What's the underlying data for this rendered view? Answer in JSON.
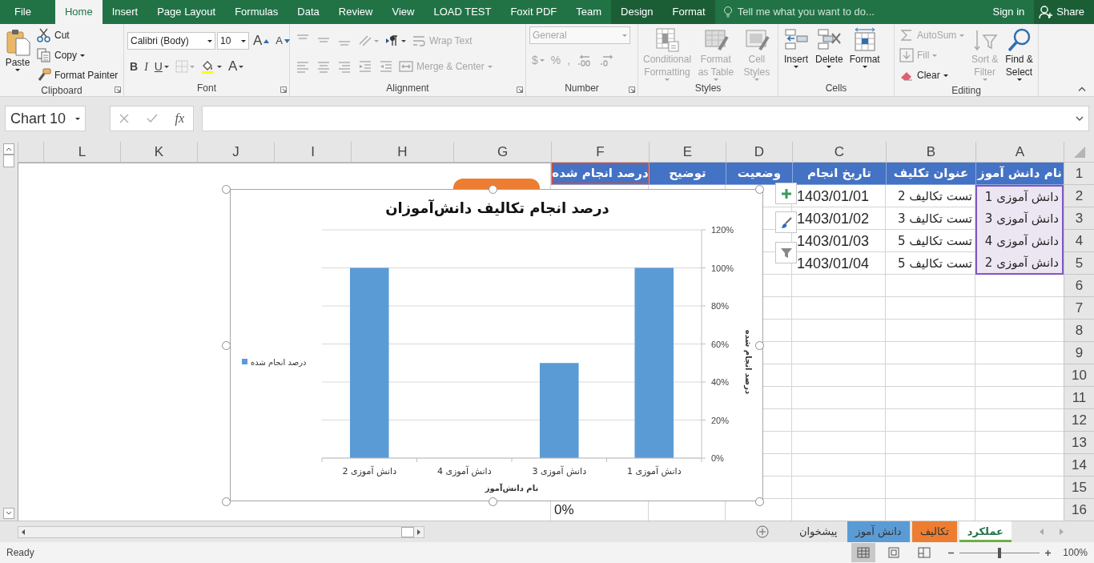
{
  "ribbon_tabs": [
    {
      "label": "Format",
      "selected": false,
      "kind": "contextual"
    },
    {
      "label": "Design",
      "selected": false,
      "kind": "contextual"
    },
    {
      "label": "Team",
      "selected": false,
      "kind": "normal"
    },
    {
      "label": "Foxit PDF",
      "selected": false,
      "kind": "normal"
    },
    {
      "label": "LOAD TEST",
      "selected": false,
      "kind": "normal"
    },
    {
      "label": "View",
      "selected": false,
      "kind": "normal"
    },
    {
      "label": "Review",
      "selected": false,
      "kind": "normal"
    },
    {
      "label": "Data",
      "selected": false,
      "kind": "normal"
    },
    {
      "label": "Formulas",
      "selected": false,
      "kind": "normal"
    },
    {
      "label": "Page Layout",
      "selected": false,
      "kind": "normal"
    },
    {
      "label": "Insert",
      "selected": false,
      "kind": "normal"
    },
    {
      "label": "Home",
      "selected": true,
      "kind": "normal"
    },
    {
      "label": "File",
      "selected": false,
      "kind": "normal"
    }
  ],
  "tell_me": {
    "placeholder": "Tell me what you want to do..."
  },
  "account": {
    "sign_in": "Sign in",
    "share": "Share"
  },
  "ribbon_groups": [
    {
      "label": "Editing",
      "launcher": false,
      "columns": [
        [
          [
            {
              "kind": "large",
              "label": "Find & Select",
              "caret": true,
              "disabled": false
            }
          ]
        ],
        [
          [
            {
              "kind": "large",
              "label": "Sort & Filter",
              "caret": true,
              "disabled": true
            }
          ]
        ],
        [
          [
            {
              "kind": "small",
              "label": "AutoSum",
              "caret": true,
              "disabled": true
            }
          ],
          [
            {
              "kind": "small",
              "label": "Fill",
              "caret": true,
              "disabled": true
            }
          ],
          [
            {
              "kind": "small",
              "label": "Clear",
              "caret": true,
              "disabled": false
            }
          ]
        ]
      ]
    },
    {
      "label": "Cells",
      "launcher": false,
      "columns": [
        [
          [
            {
              "kind": "large",
              "label": "Format",
              "caret": true,
              "disabled": false
            }
          ]
        ],
        [
          [
            {
              "kind": "large",
              "label": "Delete",
              "caret": true,
              "disabled": false
            }
          ]
        ],
        [
          [
            {
              "kind": "large",
              "label": "Insert",
              "caret": true,
              "disabled": false
            }
          ]
        ]
      ]
    },
    {
      "label": "Styles",
      "launcher": false,
      "columns": [
        [
          [
            {
              "kind": "large",
              "label": "Cell Styles",
              "caret": true,
              "disabled": true
            }
          ]
        ],
        [
          [
            {
              "kind": "large",
              "label": "Format as Table",
              "caret": true,
              "disabled": true
            }
          ]
        ],
        [
          [
            {
              "kind": "large",
              "label": "Conditional Formatting",
              "caret": true,
              "disabled": true
            }
          ]
        ]
      ]
    },
    {
      "label": "Number",
      "launcher": true,
      "columns": [
        [
          [
            {
              "kind": "combo",
              "value": "General",
              "disabled": true
            }
          ],
          [
            {
              "kind": "icon",
              "caret": false,
              "disabled": true
            },
            {
              "kind": "icon",
              "caret": false,
              "disabled": true
            },
            {
              "kind": "letter",
              "label": ",",
              "caret": false,
              "disabled": true
            },
            {
              "kind": "letter",
              "label": "%",
              "caret": false,
              "disabled": true
            },
            {
              "kind": "letter",
              "label": "$",
              "caret": true,
              "disabled": true
            }
          ]
        ]
      ]
    },
    {
      "label": "Alignment",
      "launcher": true,
      "columns": [
        [
          [
            {
              "kind": "small",
              "label": "Wrap Text",
              "caret": false,
              "disabled": true
            },
            {
              "kind": "icon",
              "caret": true,
              "disabled": false
            },
            {
              "kind": "icon",
              "caret": true,
              "disabled": true
            },
            {
              "kind": "icon",
              "caret": false,
              "disabled": true
            },
            {
              "kind": "icon",
              "caret": false,
              "disabled": true
            },
            {
              "kind": "icon",
              "caret": false,
              "disabled": true
            }
          ],
          [
            {
              "kind": "small",
              "label": "Merge & Center",
              "caret": true,
              "disabled": true
            },
            {
              "kind": "icon",
              "caret": false,
              "disabled": true
            },
            {
              "kind": "icon",
              "caret": false,
              "disabled": true
            },
            {
              "kind": "icon",
              "caret": false,
              "disabled": true
            },
            {
              "kind": "icon",
              "caret": false,
              "disabled": true
            },
            {
              "kind": "icon",
              "caret": false,
              "disabled": true
            }
          ]
        ]
      ]
    },
    {
      "label": "Font",
      "launcher": true,
      "columns": [
        [
          [
            {
              "kind": "letter",
              "label": "A",
              "caret": false,
              "disabled": false
            },
            {
              "kind": "letter",
              "label": "A",
              "caret": false,
              "disabled": false
            },
            {
              "kind": "combo",
              "value": "10",
              "disabled": false
            },
            {
              "kind": "combo",
              "value": "Calibri (Body)",
              "disabled": false
            }
          ],
          [
            {
              "kind": "letter",
              "label": "A",
              "caret": true,
              "disabled": false
            },
            {
              "kind": "icon",
              "caret": true,
              "disabled": false
            },
            {
              "kind": "icon",
              "caret": true,
              "disabled": true
            },
            {
              "kind": "letter",
              "label": "U",
              "caret": true,
              "disabled": false
            },
            {
              "kind": "letter",
              "label": "I",
              "caret": false,
              "disabled": false
            },
            {
              "kind": "letter",
              "label": "B",
              "caret": false,
              "disabled": false
            }
          ]
        ]
      ]
    },
    {
      "label": "Clipboard",
      "launcher": true,
      "columns": [
        [
          [
            {
              "kind": "small",
              "label": "Cut",
              "caret": false,
              "disabled": false
            }
          ],
          [
            {
              "kind": "small",
              "label": "Copy",
              "caret": true,
              "disabled": false
            }
          ],
          [
            {
              "kind": "small",
              "label": "Format Painter",
              "caret": false,
              "disabled": false
            }
          ]
        ],
        [
          [
            {
              "kind": "large",
              "label": "Paste",
              "caret": true,
              "disabled": false
            }
          ]
        ]
      ]
    }
  ],
  "formula_bar": {
    "name_box": "Chart 10",
    "function_label": "fx"
  },
  "sheet": {
    "columns": [
      "A",
      "B",
      "C",
      "D",
      "E",
      "F",
      "G",
      "H",
      "I",
      "J",
      "K",
      "L"
    ],
    "row_numbers": [
      "1",
      "2",
      "3",
      "4",
      "5",
      "6",
      "7",
      "8",
      "9",
      "10",
      "11",
      "12",
      "13",
      "14",
      "15",
      "16"
    ],
    "header_row": [
      "نام دانش آموز",
      "عنوان تکلیف",
      "تاریخ انجام",
      "وضعیت",
      "توضیح",
      "درصد انجام شده"
    ],
    "rows": [
      [
        "دانش آموزی 1",
        "تست تکالیف 2",
        "1403/01/01"
      ],
      [
        "دانش آموزی 3",
        "تست تکالیف 3",
        "1403/01/02"
      ],
      [
        "دانش آموزی 4",
        "تست تکالیف 5",
        "1403/01/03"
      ],
      [
        "دانش آموزی 2",
        "تست تکالیف 5",
        "1403/01/04"
      ]
    ],
    "column_f_row_16": "0%",
    "series_name_highlighted": true,
    "category_range_highlighted": true
  },
  "chart": {
    "chart_data": {
      "type": "bar",
      "grid": true,
      "title": "درصد انجام تکالیف دانش‌آموزان",
      "xlabel": "نام دانش‌آموز",
      "ylabel": "درصد انجام شده",
      "categories": [
        "دانش آموزی 2",
        "دانش آموزی 4",
        "دانش آموزی 3",
        "دانش آموزی 1"
      ],
      "series": [
        {
          "name": "درصد انجام شده",
          "color": "#5b9bd5",
          "values": [
            1,
            0,
            0.5,
            1
          ]
        }
      ],
      "ylim": [
        0,
        1.2
      ],
      "yticks": [
        {
          "value": 0,
          "label": "0%"
        },
        {
          "value": 0.2,
          "label": "20%"
        },
        {
          "value": 0.4,
          "label": "40%"
        },
        {
          "value": 0.6,
          "label": "60%"
        },
        {
          "value": 0.8,
          "label": "80%"
        },
        {
          "value": 1,
          "label": "100%"
        },
        {
          "value": 1.2,
          "label": "120%"
        }
      ]
    }
  },
  "sheet_tabs": [
    {
      "label": "عملکرد",
      "selected": true,
      "color": "#70ad47"
    },
    {
      "label": "تکالیف",
      "selected": false,
      "color": "#ed7d31"
    },
    {
      "label": "دانش آموز",
      "selected": false,
      "color": "#5b9bd5"
    },
    {
      "label": "پیشخوان",
      "selected": false
    }
  ],
  "status_bar": {
    "status": "Ready",
    "views": [
      {
        "selected": true
      },
      {
        "selected": false
      },
      {
        "selected": false
      }
    ],
    "zoom": {
      "label": "100%",
      "level": 0.5
    }
  }
}
